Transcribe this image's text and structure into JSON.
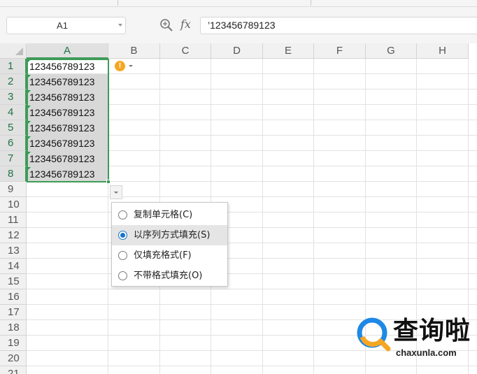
{
  "formula_bar": {
    "name_box": "A1",
    "fx_label": "fx",
    "formula_value": "’123456789123"
  },
  "columns": [
    "A",
    "B",
    "C",
    "D",
    "E",
    "F",
    "G",
    "H"
  ],
  "rows": [
    "1",
    "2",
    "3",
    "4",
    "5",
    "6",
    "7",
    "8",
    "9",
    "10",
    "11",
    "12",
    "13",
    "14",
    "15",
    "16",
    "17",
    "18",
    "19",
    "20",
    "21"
  ],
  "cells": {
    "A": [
      "123456789123",
      "123456789123",
      "123456789123",
      "123456789123",
      "123456789123",
      "123456789123",
      "123456789123",
      "123456789123"
    ]
  },
  "error_indicator": {
    "glyph": "!"
  },
  "autofill_menu": {
    "options": [
      {
        "label": "复制单元格(C)",
        "selected": false
      },
      {
        "label": "以序列方式填充(S)",
        "selected": true
      },
      {
        "label": "仅填充格式(F)",
        "selected": false
      },
      {
        "label": "不带格式填充(O)",
        "selected": false
      }
    ]
  },
  "watermark": {
    "title": "查询啦",
    "url": "chaxunla.com"
  },
  "colors": {
    "selection": "#3e9b56",
    "warning": "#f5a623",
    "radio_selected": "#1a73c9",
    "watermark_blue": "#1e88e5",
    "watermark_orange": "#f5a623"
  }
}
